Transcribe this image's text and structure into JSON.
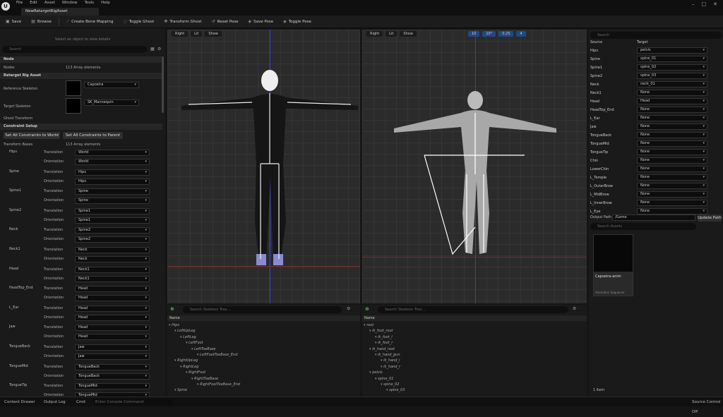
{
  "menu": [
    "File",
    "Edit",
    "Asset",
    "Window",
    "Tools",
    "Help"
  ],
  "doc_tab": "NewRetargetRigAsset",
  "toolbar": [
    {
      "icon": "save-icon",
      "label": "Save"
    },
    {
      "icon": "browse-icon",
      "label": "Browse"
    },
    {
      "icon": "bone-icon",
      "label": "Create Bone Mapping"
    },
    {
      "icon": "ghost-icon",
      "label": "Toggle Ghost"
    },
    {
      "icon": "transform-icon",
      "label": "Transform Ghost"
    },
    {
      "icon": "reset-icon",
      "label": "Reset Pose"
    },
    {
      "icon": "pose-icon",
      "label": "Save Pose"
    },
    {
      "icon": "pose-icon",
      "label": "Toggle Pose"
    }
  ],
  "details": {
    "msg": "Select an object to view details",
    "search_placeholder": "Search",
    "node_section": "Node",
    "nodes_label": "Nodes",
    "nodes_count": "113 Array elements",
    "rig_section": "Retarget Rig Asset",
    "ref_label": "Reference Skeleton",
    "ref_value": "Capoeira",
    "target_label": "Target Skeleton",
    "target_value": "SK_Mannequin",
    "ghost_section": "Ghost Transform",
    "constraint_section": "Constraint Setup",
    "btn_world": "Set All Constraints to World",
    "btn_parent": "Set All Constraints to Parent",
    "tb_label": "Transform Bases",
    "tb_count": "113 Array elements",
    "t_label": "Translation",
    "o_label": "Orientation",
    "bones": [
      {
        "name": "Hips",
        "t": "World",
        "o": "World"
      },
      {
        "name": "Spine",
        "t": "Hips",
        "o": "Hips"
      },
      {
        "name": "Spine1",
        "t": "Spine",
        "o": "Spine"
      },
      {
        "name": "Spine2",
        "t": "Spine1",
        "o": "Spine1"
      },
      {
        "name": "Neck",
        "t": "Spine2",
        "o": "Spine2"
      },
      {
        "name": "Neck1",
        "t": "Neck",
        "o": "Neck"
      },
      {
        "name": "Head",
        "t": "Neck1",
        "o": "Neck1"
      },
      {
        "name": "HeadTop_End",
        "t": "Head",
        "o": "Head"
      },
      {
        "name": "L_Ear",
        "t": "Head",
        "o": "Head"
      },
      {
        "name": "Jaw",
        "t": "Head",
        "o": "Head"
      },
      {
        "name": "TongueBack",
        "t": "Jaw",
        "o": "Jaw"
      },
      {
        "name": "TongueMid",
        "t": "TongueBack",
        "o": "TongueBack"
      },
      {
        "name": "TongueTip",
        "t": "TongueMid",
        "o": "TongueMid"
      }
    ]
  },
  "viewport1": {
    "buttons": [
      "Right",
      "Lit",
      "Show"
    ]
  },
  "viewport2": {
    "buttons": [
      "Right",
      "Lit",
      "Show"
    ],
    "stats": [
      "10",
      "10°",
      "0.25",
      "4"
    ]
  },
  "tree1": {
    "search": "Search Skeleton Tree...",
    "header": "Name",
    "items": [
      {
        "d": 0,
        "t": "Hips"
      },
      {
        "d": 1,
        "t": "LeftUpLeg"
      },
      {
        "d": 2,
        "t": "LeftLeg"
      },
      {
        "d": 3,
        "t": "LeftFoot"
      },
      {
        "d": 4,
        "t": "LeftToeBase"
      },
      {
        "d": 5,
        "t": "LeftFootToeBase_End"
      },
      {
        "d": 1,
        "t": "RightUpLeg"
      },
      {
        "d": 2,
        "t": "RightLeg"
      },
      {
        "d": 3,
        "t": "RightFoot"
      },
      {
        "d": 4,
        "t": "RightToeBase"
      },
      {
        "d": 5,
        "t": "RightFootToeBase_End"
      },
      {
        "d": 1,
        "t": "Spine"
      }
    ]
  },
  "tree2": {
    "search": "Search Skeleton Tree...",
    "header": "Name",
    "items": [
      {
        "d": 0,
        "t": "root"
      },
      {
        "d": 1,
        "t": "ik_foot_root"
      },
      {
        "d": 2,
        "t": "ik_foot_l"
      },
      {
        "d": 2,
        "t": "ik_foot_r"
      },
      {
        "d": 1,
        "t": "ik_hand_root"
      },
      {
        "d": 2,
        "t": "ik_hand_gun"
      },
      {
        "d": 3,
        "t": "ik_hand_l"
      },
      {
        "d": 3,
        "t": "ik_hand_r"
      },
      {
        "d": 1,
        "t": "pelvis"
      },
      {
        "d": 2,
        "t": "spine_01"
      },
      {
        "d": 3,
        "t": "spine_02"
      },
      {
        "d": 4,
        "t": "spine_03"
      }
    ]
  },
  "mapping": {
    "search": "Search",
    "source_hdr": "Source",
    "target_hdr": "Target",
    "rows": [
      {
        "s": "Hips",
        "t": "pelvis"
      },
      {
        "s": "Spine",
        "t": "spine_01"
      },
      {
        "s": "Spine1",
        "t": "spine_02"
      },
      {
        "s": "Spine2",
        "t": "spine_03"
      },
      {
        "s": "Neck",
        "t": "neck_01"
      },
      {
        "s": "Neck1",
        "t": "None"
      },
      {
        "s": "Head",
        "t": "Head"
      },
      {
        "s": "HeadTop_End",
        "t": "None"
      },
      {
        "s": "L_Ear",
        "t": "None"
      },
      {
        "s": "Jaw",
        "t": "None"
      },
      {
        "s": "TongueBack",
        "t": "None"
      },
      {
        "s": "TongueMid",
        "t": "None"
      },
      {
        "s": "TongueTip",
        "t": "None"
      },
      {
        "s": "Chin",
        "t": "None"
      },
      {
        "s": "LowerChin",
        "t": "None"
      },
      {
        "s": "L_Temple",
        "t": "None"
      },
      {
        "s": "L_OuterBrow",
        "t": "None"
      },
      {
        "s": "L_MidBrow",
        "t": "None"
      },
      {
        "s": "L_InnerBrow",
        "t": "None"
      },
      {
        "s": "L_Eye",
        "t": "None"
      }
    ]
  },
  "output": {
    "label": "Output Path",
    "path": "/Game",
    "btn": "Update Path",
    "search": "Search Assets",
    "asset_name": "Capoeira-anim",
    "asset_type": "Animation Sequence",
    "count": "1 item"
  },
  "status": {
    "drawer": "Content Drawer",
    "log": "Output Log",
    "cmd": "Cmd",
    "console": "Enter Console Command",
    "source": "Source Control Off"
  }
}
